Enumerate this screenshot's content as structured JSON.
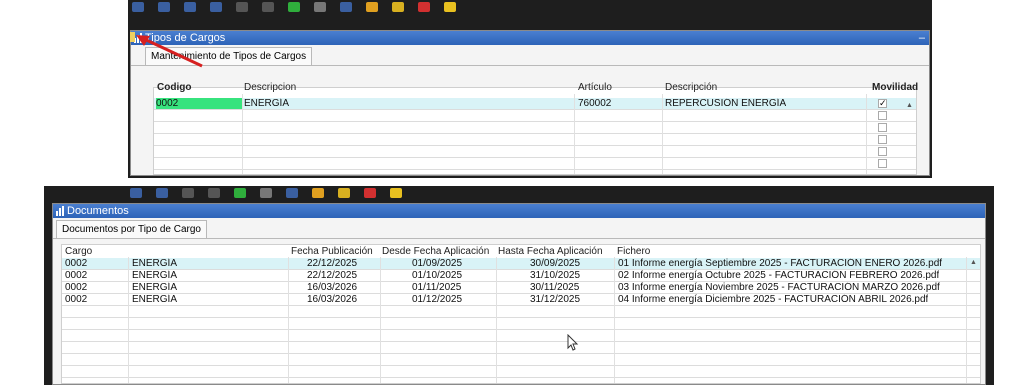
{
  "colors": {
    "accent": "#2d63b8",
    "selection": "#d9f3f7",
    "highlight": "#37e37e",
    "dark_bg": "#1e1e1e",
    "arrow": "#d62020"
  },
  "win1": {
    "title": "Tipos de Cargos",
    "tab": "Mantenimiento de Tipos de Cargos",
    "headers": {
      "codigo": "Codigo",
      "descripcion": "Descripcion",
      "articulo": "Artículo",
      "descripcion2": "Descripción",
      "movilidad": "Movilidad"
    },
    "rows": [
      {
        "codigo": "0002",
        "descripcion": "ENERGÍA",
        "articulo": "760002",
        "descripcion2": "REPERCUSIÓN ENERGÍA",
        "movilidad": true
      }
    ]
  },
  "win2": {
    "title": "Documentos",
    "tab": "Documentos por Tipo de Cargo",
    "headers": {
      "cargo": "Cargo",
      "fecha_pub": "Fecha Publicación",
      "desde": "Desde Fecha Aplicación",
      "hasta": "Hasta Fecha Aplicación",
      "fichero": "Fichero"
    },
    "rows": [
      {
        "cargo": "0002",
        "desc": "ENERGÍA",
        "fecha_pub": "22/12/2025",
        "desde": "01/09/2025",
        "hasta": "30/09/2025",
        "fichero": "01 Informe energía Septiembre 2025 - FACTURACIÓN ENERO 2026.pdf"
      },
      {
        "cargo": "0002",
        "desc": "ENERGÍA",
        "fecha_pub": "22/12/2025",
        "desde": "01/10/2025",
        "hasta": "31/10/2025",
        "fichero": "02 Informe energía Octubre 2025 - FACTURACIÓN FEBRERO 2026.pdf"
      },
      {
        "cargo": "0002",
        "desc": "ENERGÍA",
        "fecha_pub": "16/03/2026",
        "desde": "01/11/2025",
        "hasta": "30/11/2025",
        "fichero": "03 Informe energía Noviembre 2025 - FACTURACIÓN MARZO 2026.pdf"
      },
      {
        "cargo": "0002",
        "desc": "ENERGÍA",
        "fecha_pub": "16/03/2026",
        "desde": "01/12/2025",
        "hasta": "31/12/2025",
        "fichero": "04 Informe energía Diciembre 2025 - FACTURACIÓN ABRIL 2026.pdf"
      }
    ]
  }
}
